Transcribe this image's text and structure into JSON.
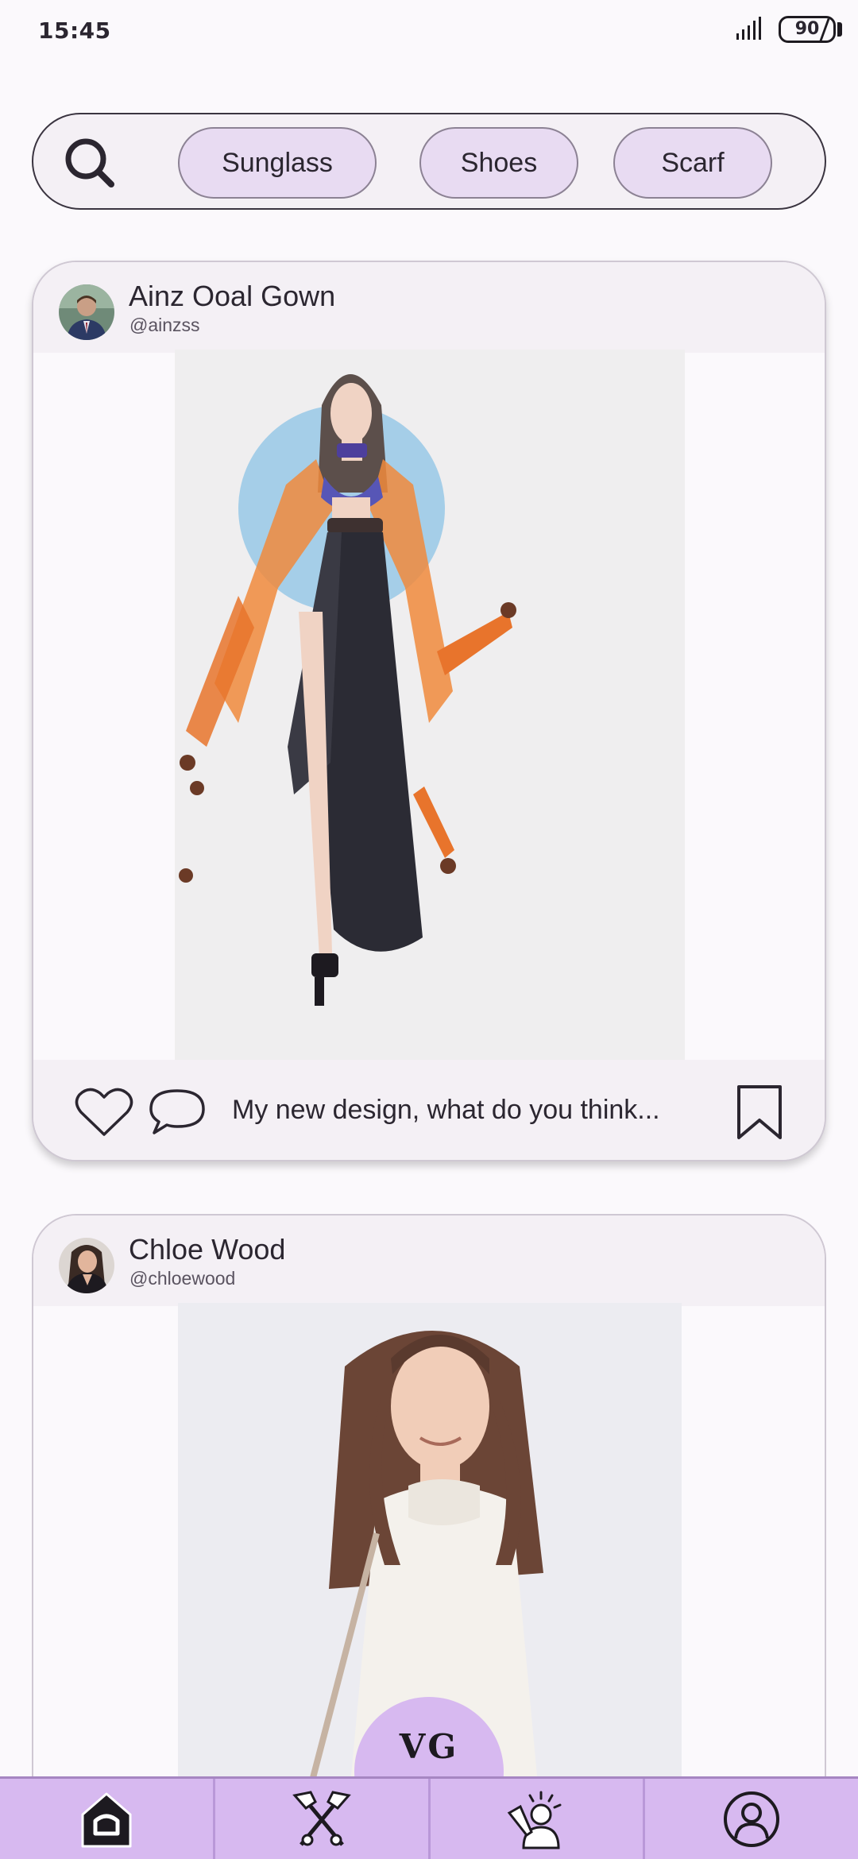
{
  "status_bar": {
    "time": "15:45",
    "battery": "90"
  },
  "filters": {
    "chips": [
      {
        "label": "Sunglass"
      },
      {
        "label": "Shoes"
      },
      {
        "label": "Scarf"
      }
    ]
  },
  "posts": [
    {
      "author": "Ainz Ooal Gown",
      "handle": "@ainzss",
      "caption": "My new design, what do you think..."
    },
    {
      "author": "Chloe Wood",
      "handle": "@chloewood"
    }
  ],
  "brand": {
    "badge": "VG"
  },
  "nav": {
    "items": [
      {
        "icon": "home-icon"
      },
      {
        "icon": "tailor-icon"
      },
      {
        "icon": "creator-icon"
      },
      {
        "icon": "profile-icon"
      }
    ]
  },
  "colors": {
    "accent": "#d7b9f0",
    "chip": "#e8dbf2",
    "background": "#fbf9fc"
  }
}
